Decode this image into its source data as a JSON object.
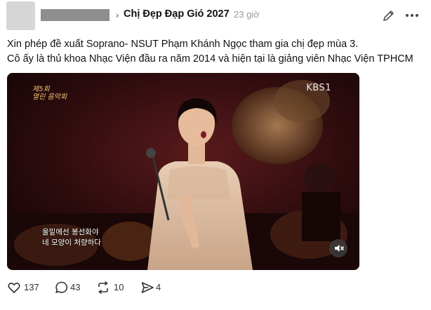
{
  "header": {
    "community": "Chị Đẹp Đạp Gió 2027",
    "time": "23 giờ",
    "chevron": "›"
  },
  "post": {
    "line1": "Xin phép đề xuất Soprano- NSUT Phạm Khánh Ngọc tham gia chị đẹp mùa 3.",
    "line2": "Cô ấy là thủ khoa Nhạc Viện đầu ra năm 2014 và hiện tại là giảng viên Nhạc Viện TPHCM"
  },
  "video": {
    "channel": "KBS1",
    "show_logo_line1": "제5회",
    "show_logo_line2": "열린 음악회",
    "subtitle_line1": "울밑에선 봉선화야",
    "subtitle_line2": "네 모양이 처량하다",
    "muted_icon": "speaker-muted-icon"
  },
  "actions": {
    "likes": "137",
    "comments": "43",
    "reposts": "10",
    "shares": "4"
  },
  "icons": {
    "like": "heart-icon",
    "comment": "speech-bubble-icon",
    "repost": "repost-arrows-icon",
    "share": "paper-plane-icon",
    "edit": "pencil-icon",
    "more": "more-horizontal-icon"
  }
}
